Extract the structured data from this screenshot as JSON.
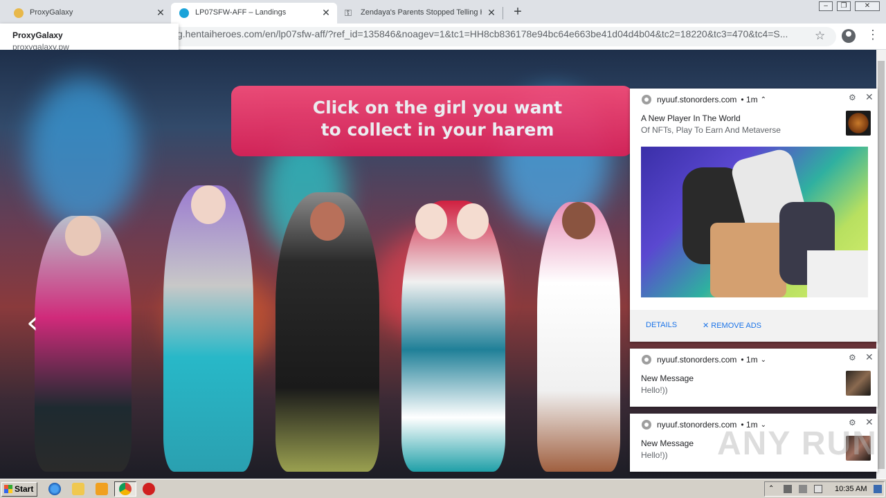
{
  "tabs": [
    {
      "title": "ProxyGalaxy",
      "active": false
    },
    {
      "title": "LP07SFW-AFF – Landings",
      "active": true
    },
    {
      "title": "Zendaya's Parents Stopped Telling H",
      "active": false
    }
  ],
  "new_tab_label": "+",
  "hovercard": {
    "title": "ProxyGalaxy",
    "url": "proxygalaxy.pw"
  },
  "address_bar": {
    "url": "g.hentaiheroes.com/en/lp07sfw-aff/?ref_id=135846&noagev=1&tc1=HH8cb836178e94bc64e663be41d04d4b04&tc2=18220&tc3=470&tc4=S..."
  },
  "page": {
    "banner_line1": "Click on the girl you want",
    "banner_line2": "to collect in your harem",
    "prev_arrow": "‹"
  },
  "notifications": [
    {
      "source": "nyuuf.stonorders.com",
      "age": "• 1m",
      "title": "A New Player In The World",
      "message": "Of NFTs, Play To Earn And Metaverse",
      "actions": {
        "details": "DETAILS",
        "remove": "✕ REMOVE ADS"
      }
    },
    {
      "source": "nyuuf.stonorders.com",
      "age": "• 1m",
      "title": "New Message",
      "message": "Hello!))"
    },
    {
      "source": "nyuuf.stonorders.com",
      "age": "• 1m",
      "title": "New Message",
      "message": "Hello!))"
    }
  ],
  "taskbar": {
    "start_label": "Start",
    "clock": "10:35 AM"
  },
  "watermark": "ANY RUN",
  "colors": {
    "banner": "#e01f56",
    "accent_link": "#1a73e8",
    "taskbar": "#d4d0c8"
  }
}
